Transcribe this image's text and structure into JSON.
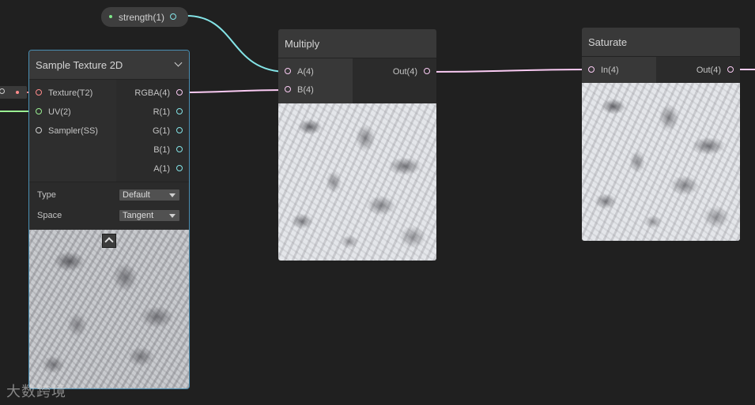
{
  "graph": {
    "property_node": {
      "label": "strength(1)"
    },
    "sample_texture": {
      "title": "Sample Texture 2D",
      "inputs": [
        "Texture(T2)",
        "UV(2)",
        "Sampler(SS)"
      ],
      "outputs": [
        "RGBA(4)",
        "R(1)",
        "G(1)",
        "B(1)",
        "A(1)"
      ],
      "settings": [
        {
          "label": "Type",
          "value": "Default"
        },
        {
          "label": "Space",
          "value": "Tangent"
        }
      ]
    },
    "multiply": {
      "title": "Multiply",
      "inputs": [
        "A(4)",
        "B(4)"
      ],
      "outputs": [
        "Out(4)"
      ]
    },
    "saturate": {
      "title": "Saturate",
      "inputs": [
        "In(4)"
      ],
      "outputs": [
        "Out(4)"
      ]
    }
  },
  "colors": {
    "background": "#202020",
    "wire_vector1": "#84e4e7",
    "wire_vector4": "#fbcbf4",
    "wire_vector2": "#9aef92",
    "wire_texture": "#ff8b8b",
    "selection": "#4a8fb3"
  },
  "watermark": {
    "text": "大数跨境"
  }
}
